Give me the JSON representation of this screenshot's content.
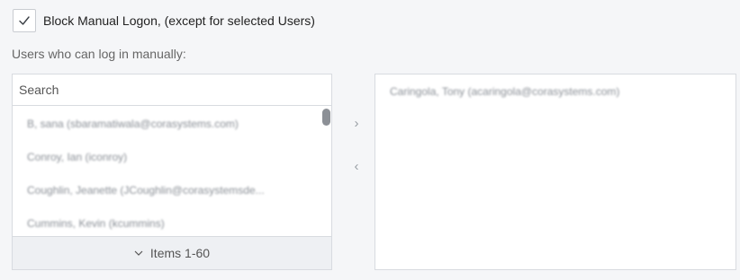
{
  "block_manual_logon": {
    "checked": true,
    "label": "Block Manual Logon, (except for selected Users)"
  },
  "users_label": "Users who can log in manually:",
  "available_list": {
    "search_placeholder": "Search",
    "items": [
      "B, sana (sbaramatiwala@corasystems.com)",
      "Conroy, Ian (iconroy)",
      "Coughlin, Jeanette (JCoughlin@corasystemsde...",
      "Cummins, Kevin (kcummins)"
    ],
    "pager_label": "Items 1-60",
    "pager_icon": "chevron-down-icon"
  },
  "move_buttons": {
    "add_icon": "›",
    "remove_icon": "‹"
  },
  "selected_list": {
    "items": [
      "Caringola, Tony (acaringola@corasystems.com)"
    ]
  }
}
